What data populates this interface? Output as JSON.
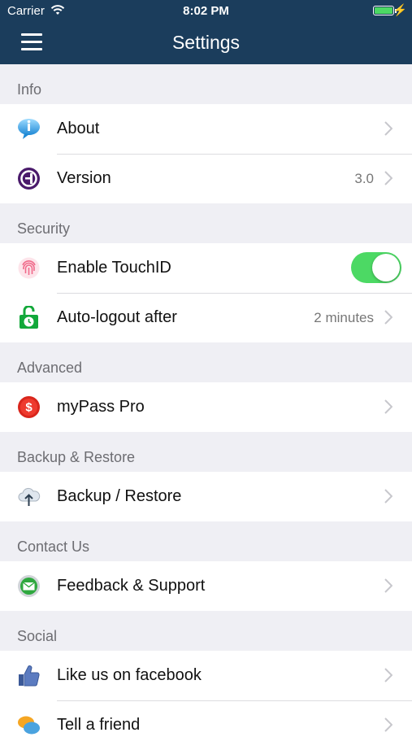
{
  "status_bar": {
    "carrier": "Carrier",
    "time": "8:02 PM"
  },
  "nav": {
    "title": "Settings"
  },
  "sections": {
    "info": {
      "header": "Info",
      "about": {
        "label": "About"
      },
      "version": {
        "label": "Version",
        "value": "3.0"
      }
    },
    "security": {
      "header": "Security",
      "touchid": {
        "label": "Enable TouchID",
        "enabled": true
      },
      "autologout": {
        "label": "Auto-logout after",
        "value": "2 minutes"
      }
    },
    "advanced": {
      "header": "Advanced",
      "pro": {
        "label": "myPass Pro"
      }
    },
    "backup": {
      "header": "Backup & Restore",
      "backup_restore": {
        "label": "Backup / Restore"
      }
    },
    "contact": {
      "header": "Contact Us",
      "feedback": {
        "label": "Feedback & Support"
      }
    },
    "social": {
      "header": "Social",
      "facebook": {
        "label": "Like us on facebook"
      },
      "tell_friend": {
        "label": "Tell a friend"
      }
    }
  },
  "colors": {
    "nav_bg": "#1b3d5c",
    "toggle_on": "#4cd964",
    "section_bg": "#efeff4"
  }
}
